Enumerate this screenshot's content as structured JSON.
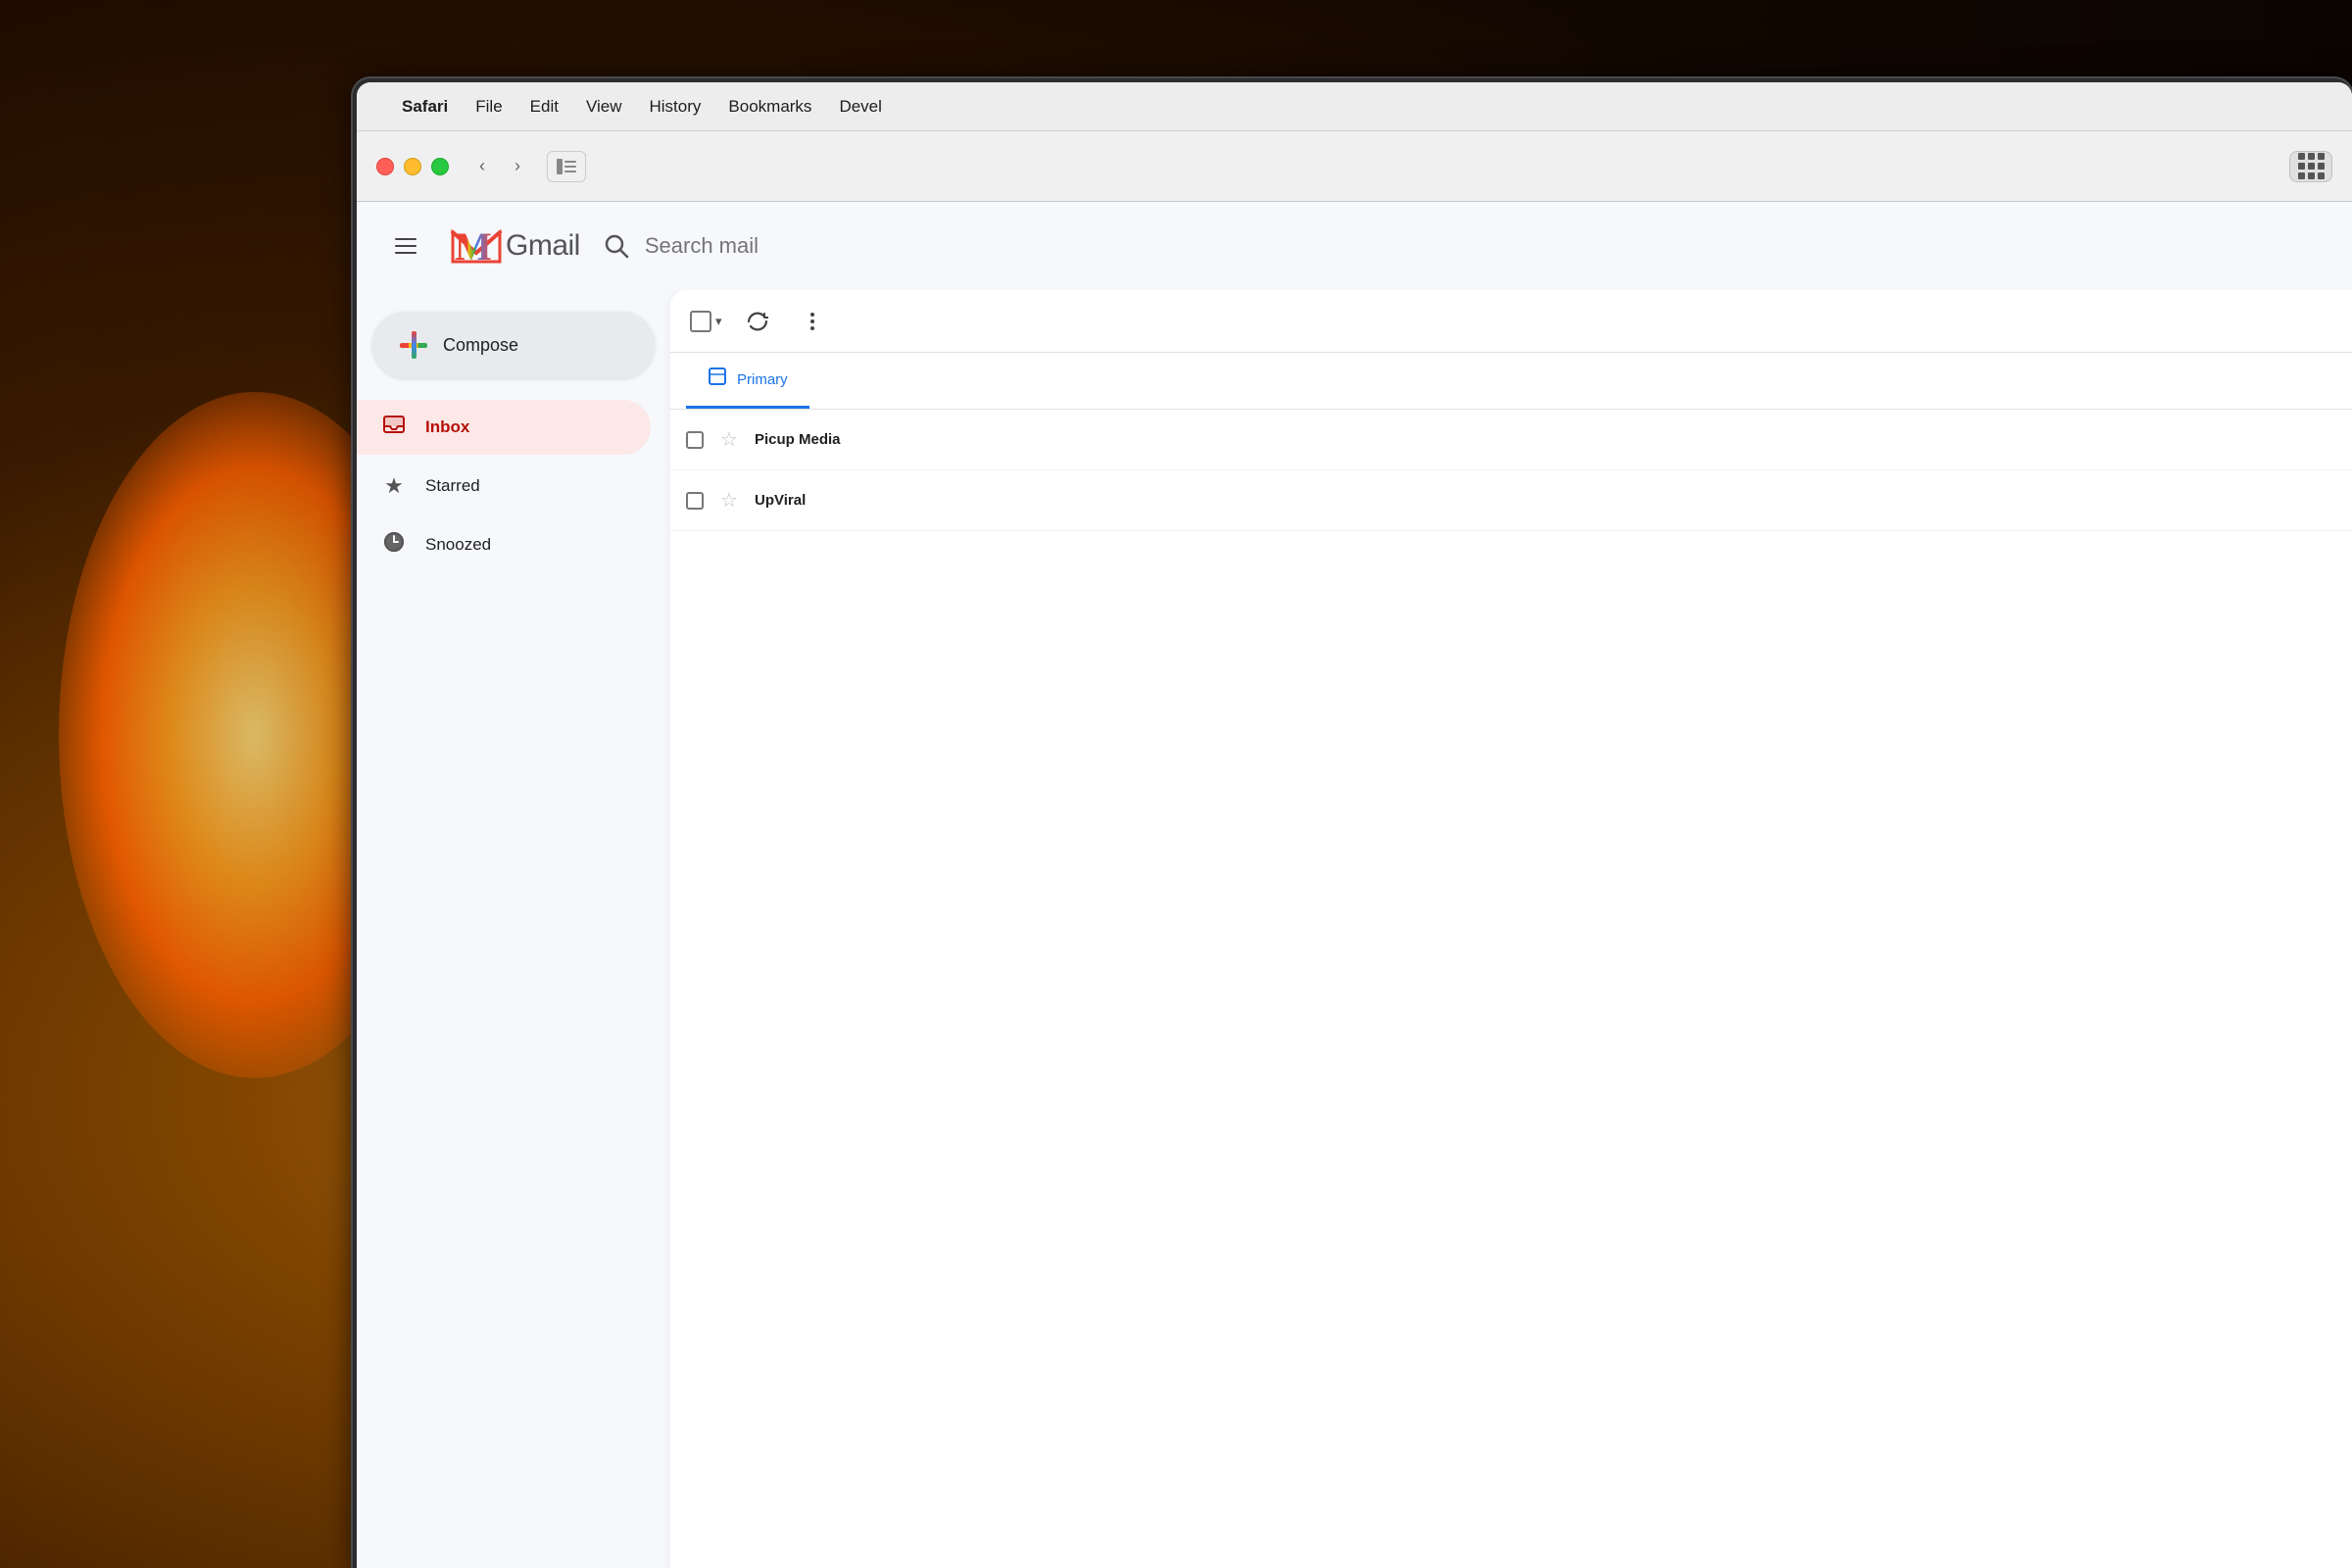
{
  "background": {
    "color_dark": "#1a0f00",
    "color_light": "#c47a20"
  },
  "macos_menubar": {
    "apple_symbol": "",
    "items": [
      {
        "label": "Safari",
        "bold": true
      },
      {
        "label": "File",
        "bold": false
      },
      {
        "label": "Edit",
        "bold": false
      },
      {
        "label": "View",
        "bold": false
      },
      {
        "label": "History",
        "bold": false
      },
      {
        "label": "Bookmarks",
        "bold": false
      },
      {
        "label": "Devel",
        "bold": false
      }
    ]
  },
  "safari_chrome": {
    "back_label": "‹",
    "forward_label": "›",
    "sidebar_icon": "⊞"
  },
  "gmail": {
    "app_name": "Gmail",
    "logo_letter": "M",
    "search_placeholder": "Search mail",
    "compose_label": "Compose",
    "sidebar_items": [
      {
        "id": "inbox",
        "label": "Inbox",
        "icon": "📥",
        "active": true
      },
      {
        "id": "starred",
        "label": "Starred",
        "icon": "★",
        "active": false
      },
      {
        "id": "snoozed",
        "label": "Snoozed",
        "icon": "🕐",
        "active": false
      }
    ],
    "tabs": [
      {
        "id": "primary",
        "label": "Primary",
        "icon": "☐",
        "active": true
      }
    ],
    "email_rows": [
      {
        "sender": "Picup Media",
        "subject": "",
        "starred": false
      },
      {
        "sender": "UpViral",
        "subject": "",
        "starred": false
      }
    ],
    "toolbar": {
      "refresh_icon": "↺",
      "more_icon": "⋮"
    }
  }
}
